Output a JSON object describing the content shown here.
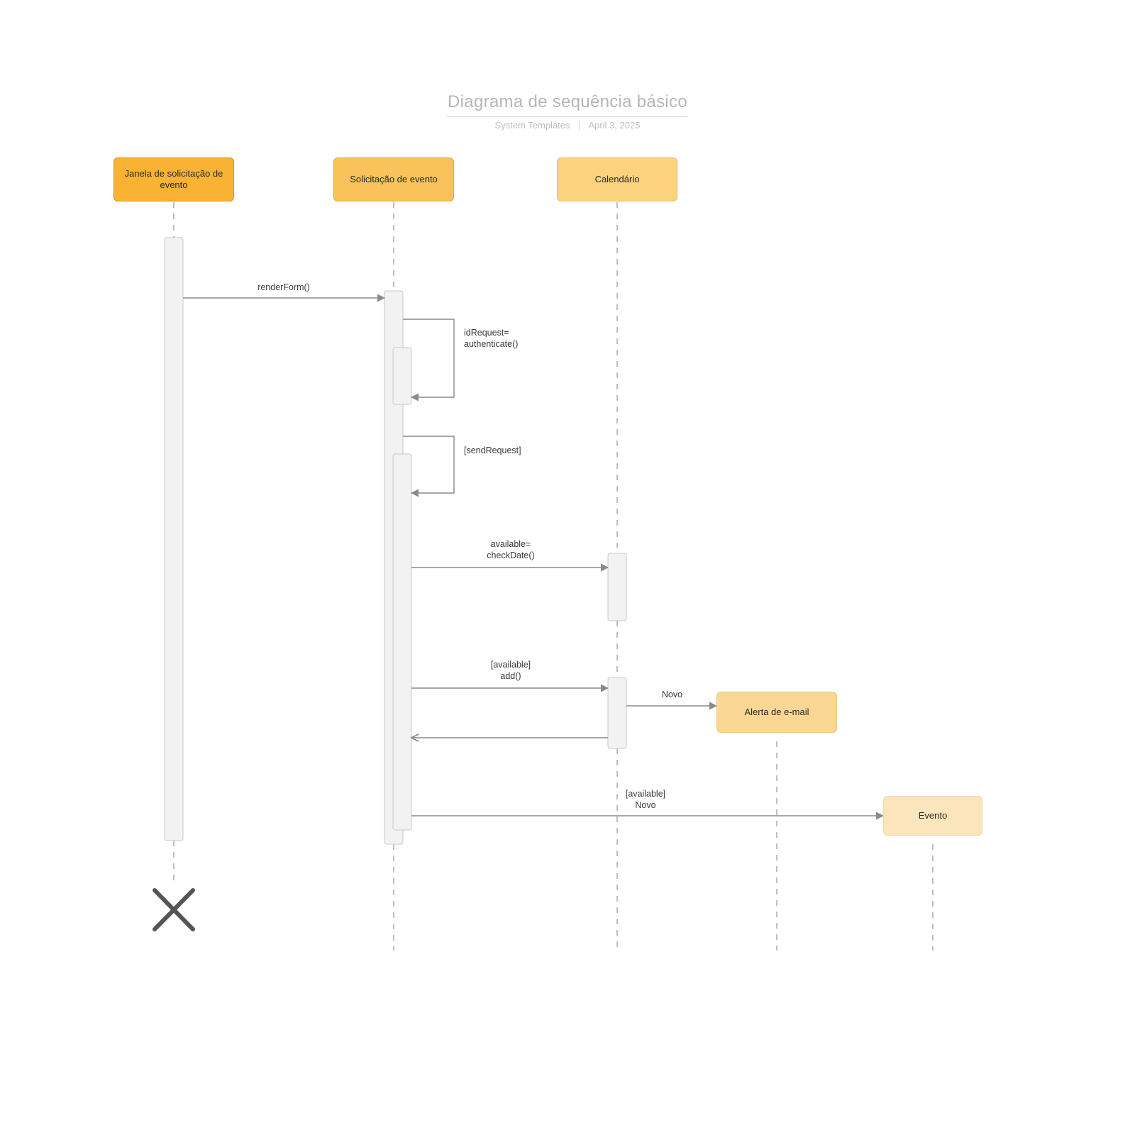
{
  "title": {
    "main": "Diagrama de sequência básico",
    "subtitle_left": "System Templates",
    "subtitle_right": "April 3, 2025"
  },
  "participants": {
    "p1": "Janela de solicitação de evento",
    "p2": "Solicitação de evento",
    "p3": "Calendário",
    "p4": "Alerta de e-mail",
    "p5": "Evento"
  },
  "messages": {
    "m1": "renderForm()",
    "m2": "idRequest=\nauthenticate()",
    "m3": "[sendRequest]",
    "m4": "available=\ncheckDate()",
    "m5": "[available]\nadd()",
    "m6": "Novo",
    "m7": "[available]\nNovo"
  },
  "colors": {
    "lifeline": "#bfbfbf",
    "activation_fill": "#f2f2f2",
    "activation_stroke": "#c9c9c9",
    "arrow": "#8a8a8a",
    "cross": "#555"
  }
}
